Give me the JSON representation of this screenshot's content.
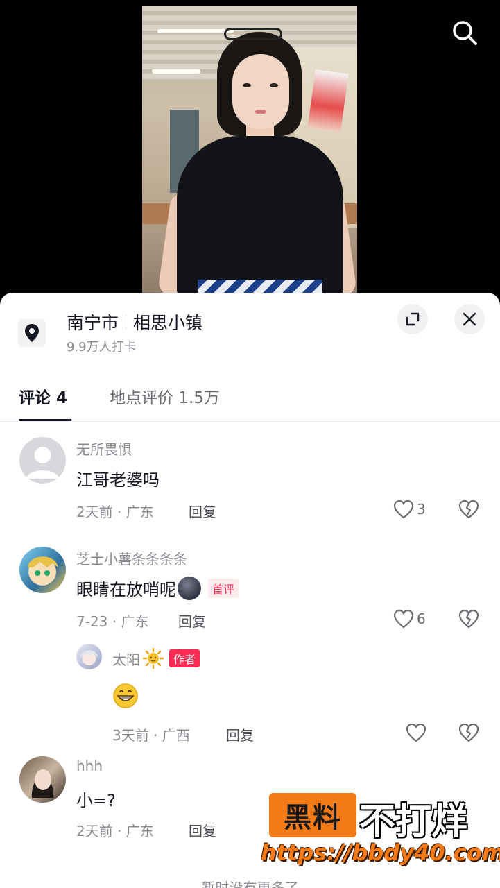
{
  "location": {
    "city": "南宁市",
    "place": "相思小镇",
    "checkins": "9.9万人打卡"
  },
  "tabs": [
    {
      "label": "评论 4"
    },
    {
      "label": "地点评价 1.5万"
    }
  ],
  "comments": [
    {
      "username": "无所畏惧",
      "text": "江哥老婆吗",
      "meta": "2天前 · 广东",
      "reply_label": "回复",
      "likes": "3"
    },
    {
      "username": "芝士小薯条条条条",
      "text": "眼睛在放哨呢",
      "badge": "首评",
      "meta": "7-23 · 广东",
      "reply_label": "回复",
      "likes": "6",
      "replies": [
        {
          "username": "太阳",
          "badge": "作者",
          "meta": "3天前 · 广西",
          "reply_label": "回复"
        }
      ]
    },
    {
      "username": "hhh",
      "text": "小=?",
      "meta": "2天前 · 广东",
      "reply_label": "回复"
    }
  ],
  "footer_note": "暂时没有更多了",
  "watermark": {
    "box_text": "黑料",
    "text": "不打烊",
    "url": "https://bbdy40.com"
  },
  "icons": {
    "search": "search-icon",
    "location": "location-pin-icon",
    "expand": "expand-icon",
    "close": "close-icon",
    "like": "heart-outline-icon",
    "dislike": "broken-heart-icon"
  },
  "colors": {
    "accent": "#fe2c55",
    "watermark_orange": "#f47a17",
    "text_primary": "#161823",
    "text_secondary": "#8a8b91"
  }
}
